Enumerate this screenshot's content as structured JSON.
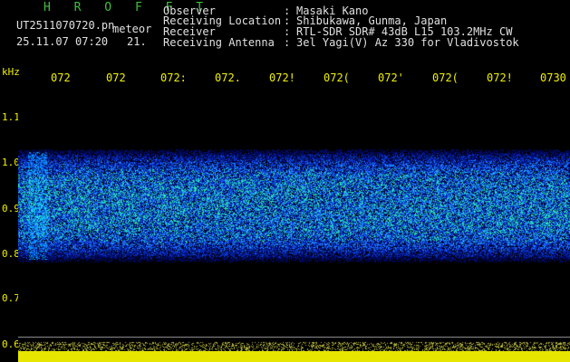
{
  "header": {
    "brand": "H R O F F T",
    "filename": "UT2511070720.pn",
    "filename_suffix": "meteor",
    "datetime": "25.11.07 07:20",
    "seconds": "21."
  },
  "info": [
    {
      "label": "Observer",
      "value": "Masaki Kano"
    },
    {
      "label": "Receiving Location",
      "value": "Shibukawa, Gunma, Japan"
    },
    {
      "label": "Receiver",
      "value": "RTL-SDR SDR# 43dB L15 103.2MHz CW"
    },
    {
      "label": "Receiving Antenna",
      "value": "3el Yagi(V) Az 330 for Vladivostok"
    }
  ],
  "axis": {
    "unit": "kHz",
    "y_ticks": [
      "1.1",
      "1.0",
      "0.9",
      "0.8",
      "0.7",
      "0.6"
    ],
    "x_ticks": [
      "072",
      "072",
      "072:",
      "072.",
      "072!",
      "072(",
      "072'",
      "072(",
      "072!",
      "0730"
    ]
  },
  "colors": {
    "background": "#000000",
    "text": "#e0e0e0",
    "axis": "#f0f000",
    "brand": "#3fbf3f",
    "signal_low": "#0a1a9a",
    "signal_mid": "#2a6bff",
    "signal_high": "#3fe0a0",
    "level_bar": "#e6e600"
  }
}
